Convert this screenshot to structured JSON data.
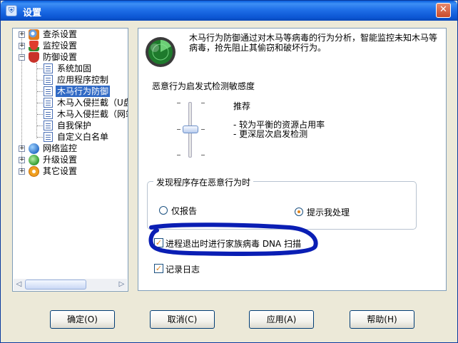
{
  "window": {
    "title": "设置",
    "close_glyph": "✕"
  },
  "tree": {
    "items": [
      {
        "label": "查杀设置",
        "icon": "scan-icon",
        "expander": "+"
      },
      {
        "label": "监控设置",
        "icon": "umbrella-icon",
        "expander": "+"
      },
      {
        "label": "防御设置",
        "icon": "shield-icon",
        "expander": "−"
      },
      {
        "label": "系统加固",
        "icon": "document-icon"
      },
      {
        "label": "应用程序控制",
        "icon": "document-icon"
      },
      {
        "label": "木马行为防御",
        "icon": "document-icon",
        "selected": true
      },
      {
        "label": "木马入侵拦截（U盘",
        "icon": "document-icon"
      },
      {
        "label": "木马入侵拦截（网站",
        "icon": "document-icon"
      },
      {
        "label": "自我保护",
        "icon": "document-icon"
      },
      {
        "label": "自定义白名单",
        "icon": "document-icon"
      },
      {
        "label": "网络监控",
        "icon": "globe-icon",
        "expander": "+"
      },
      {
        "label": "升级设置",
        "icon": "update-icon",
        "expander": "+"
      },
      {
        "label": "其它设置",
        "icon": "gear-icon",
        "expander": "+"
      }
    ],
    "scroll_left": "◁",
    "scroll_right": "▷"
  },
  "content": {
    "description": "木马行为防御通过对木马等病毒的行为分析，智能监控未知木马等病毒，抢先阻止其偷窃和破坏行为。",
    "sensitivity_title": "恶意行为启发式检测敏感度",
    "level_name": "推荐",
    "level_desc": [
      "- 较为平衡的资源占用率",
      "- 更深层次启发检测"
    ],
    "action_group": {
      "title": "发现程序存在恶意行为时",
      "options": [
        "仅报告",
        "提示我处理"
      ],
      "selected": "提示我处理"
    },
    "dna_scan": {
      "label": "进程退出时进行家族病毒 DNA 扫描",
      "checked": true
    },
    "log": {
      "label": "记录日志",
      "checked": true
    },
    "check_glyph": "✓"
  },
  "buttons": {
    "ok": "确定(O)",
    "cancel": "取消(C)",
    "apply": "应用(A)",
    "help": "帮助(H)"
  },
  "colors": {
    "title_bar": "#0b55d3",
    "selection": "#316ac5",
    "annotation_ink": "#0a1eb4",
    "check_accent": "#e0841c"
  }
}
